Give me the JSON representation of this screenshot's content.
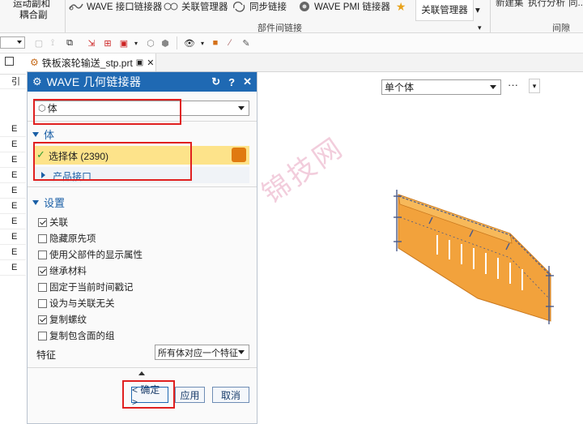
{
  "ribbon": {
    "left_top_label": "运动副和",
    "left_bottom_label": "耦合副",
    "wave_linker": "WAVE 接口链接器",
    "assoc_manager": "关联管理器",
    "sync_link": "同步链接",
    "wave_pmi": "WAVE PMI 链接器",
    "assoc_manager_btn": "关联管理器",
    "group_label": "部件间链接",
    "right_label_1": "新建集",
    "right_label_2": "执行分析",
    "right_label_3": "同...",
    "right_group_label": "间隙"
  },
  "left_strip": {
    "header": "引",
    "rows": [
      "E",
      "E",
      "E",
      "E",
      "E",
      "E",
      "E",
      "E",
      "E",
      "E"
    ]
  },
  "tab": {
    "label": "铁板滚轮输送_stp.prt"
  },
  "viewport": {
    "filter_value": "单个体",
    "more": "···",
    "watermark": "锦技网",
    "colors": {
      "part": "#f2a23c",
      "edge": "#4a5a8a"
    }
  },
  "dialog": {
    "title": "WAVE 几何链接器",
    "type_value": "体",
    "body_section": "体",
    "select_body": "选择体 (2390)",
    "product_interface": "产品接口",
    "settings_section": "设置",
    "options": [
      {
        "label": "关联",
        "checked": true
      },
      {
        "label": "隐藏原先项",
        "checked": false
      },
      {
        "label": "使用父部件的显示属性",
        "checked": false
      },
      {
        "label": "继承材料",
        "checked": true
      },
      {
        "label": "固定于当前时间戳记",
        "checked": false
      },
      {
        "label": "设为与关联无关",
        "checked": false
      },
      {
        "label": "复制螺纹",
        "checked": true
      },
      {
        "label": "复制包含面的组",
        "checked": false
      }
    ],
    "feature_label": "特征",
    "feature_value": "所有体对应一个特征",
    "ok": "< 确定 >",
    "apply": "应用",
    "cancel": "取消",
    "colors": {
      "title_bar": "#1f69b3",
      "selected_row": "#fde38a",
      "accent": "#1a5fa6"
    }
  }
}
